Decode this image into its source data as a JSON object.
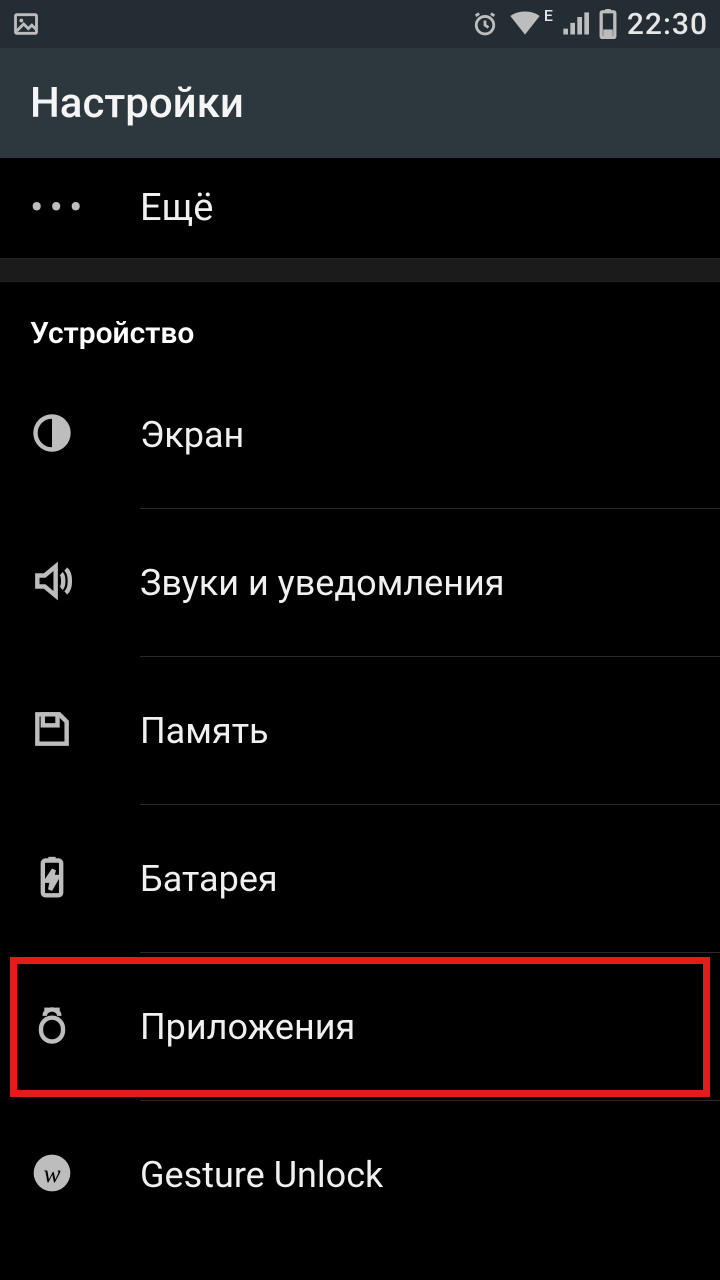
{
  "statusbar": {
    "time": "22:30",
    "network_letter": "E"
  },
  "appbar": {
    "title": "Настройки"
  },
  "rows": {
    "more": "Ещё",
    "section": "Устройство",
    "display": "Экран",
    "sound": "Звуки и уведомления",
    "storage": "Память",
    "battery": "Батарея",
    "apps": "Приложения",
    "gesture": "Gesture Unlock"
  }
}
